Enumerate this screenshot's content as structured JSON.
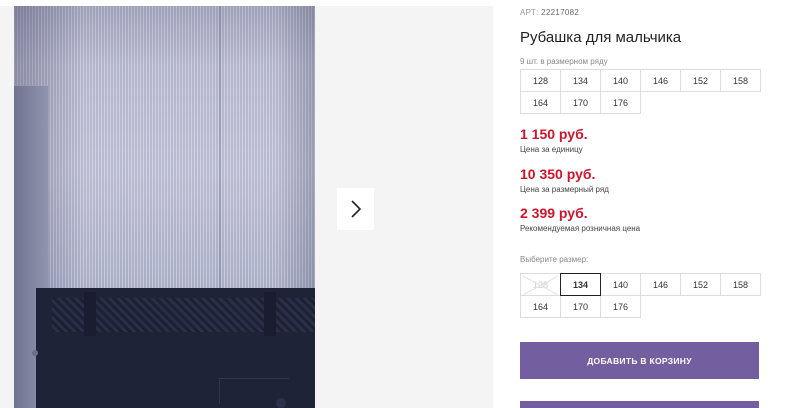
{
  "product": {
    "art_label": "АРТ:",
    "art_value": "22217082",
    "title": "Рубашка для мальчика",
    "in_row_label": "9 шт. в размерном ряду",
    "row_sizes": [
      "128",
      "134",
      "140",
      "146",
      "152",
      "158",
      "164",
      "170",
      "176"
    ],
    "prices": [
      {
        "amount": "1 150 руб.",
        "note": "Цена за единицу"
      },
      {
        "amount": "10 350 руб.",
        "note": "Цена за размерный ряд"
      },
      {
        "amount": "2 399 руб.",
        "note": "Рекомендуемая розничная цена"
      }
    ],
    "choose_label": "Выберите размер:",
    "choose_sizes": [
      "128",
      "134",
      "140",
      "146",
      "152",
      "158",
      "164",
      "170",
      "176"
    ],
    "selected_size": "134",
    "unavailable_size": "128",
    "add_to_cart_label": "ДОБАВИТЬ В КОРЗИНУ"
  },
  "colors": {
    "price": "#d0142c",
    "button": "#735ea0",
    "gallery_bg": "#f4f4f4"
  },
  "icons": {
    "next": "chevron-right-icon"
  }
}
